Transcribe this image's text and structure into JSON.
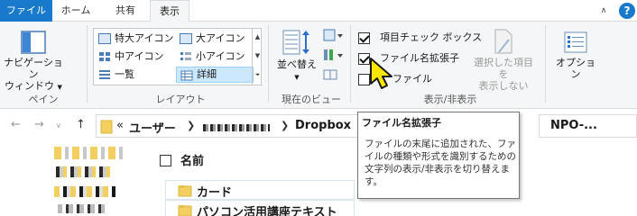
{
  "tabs": {
    "file": "ファイル",
    "home": "ホーム",
    "share": "共有",
    "view": "表示"
  },
  "ribbon": {
    "pane_group": {
      "nav_pane_line1": "ナビゲーション",
      "nav_pane_line2": "ウィンドウ",
      "label": "ペイン"
    },
    "layout_group": {
      "items": [
        "特大アイコン",
        "大アイコン",
        "中アイコン",
        "小アイコン",
        "一覧",
        "詳細"
      ],
      "selected": "詳細",
      "label": "レイアウト"
    },
    "current_view_group": {
      "sort_label": "並べ替え",
      "label": "現在のビュー"
    },
    "show_hide_group": {
      "item_checkboxes": "項目チェック ボックス",
      "file_extensions": "ファイル名拡張子",
      "hidden_files": "ファイル",
      "hide_selected_line1": "選択した項目を",
      "hide_selected_line2": "表示しない",
      "label": "表示/非表示"
    },
    "options_label": "オプション"
  },
  "address": {
    "overflow": "«",
    "crumbs": [
      "ユーザー",
      "Dropbox"
    ],
    "search_partial": "NPO-..."
  },
  "file_list": {
    "column_name": "名前",
    "items": [
      "カード",
      "パソコン活用講座テキスト"
    ]
  },
  "tooltip": {
    "title": "ファイル名拡張子",
    "body": "ファイルの末尾に追加された、ファイルの種類や形式を識別するための文字列の表示/非表示を切り替えます。"
  },
  "colors": {
    "accent": "#1979ca",
    "ribbon_bg": "#f5f6f7",
    "selected_bg": "#cce8ff",
    "cursor": "#ffe600",
    "folder": "#f3cf5f"
  }
}
